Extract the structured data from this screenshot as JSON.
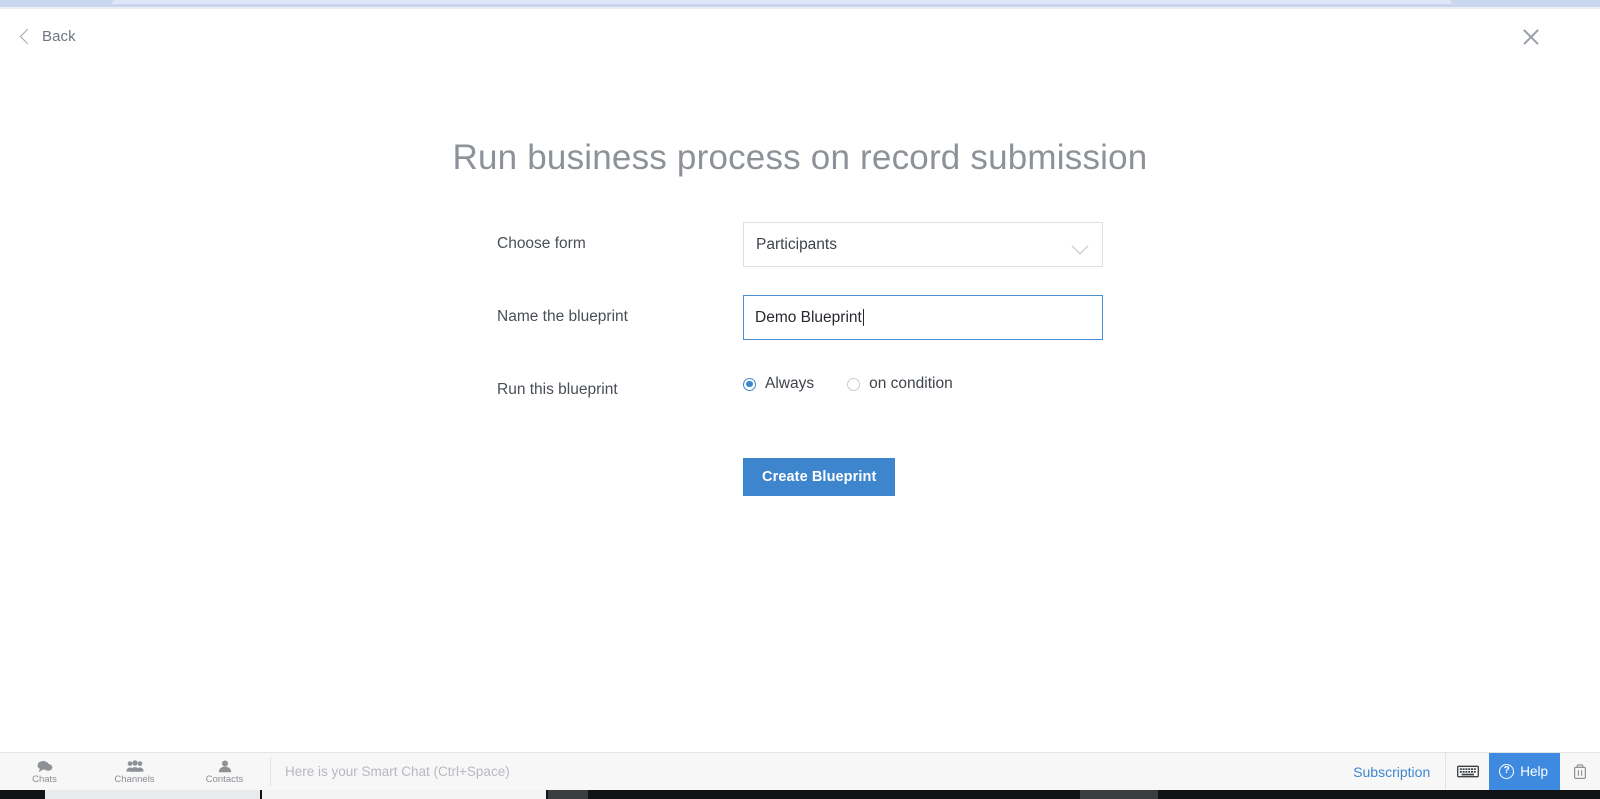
{
  "header": {
    "back_label": "Back",
    "back_icon": "chevron-left-icon",
    "close_icon": "close-icon"
  },
  "main": {
    "title": "Run business process on record submission",
    "rows": [
      {
        "label": "Choose form",
        "type": "select",
        "value": "Participants",
        "icon": "chevron-down-icon"
      },
      {
        "label": "Name the blueprint",
        "type": "text",
        "value": "Demo Blueprint",
        "placeholder": "",
        "focused": true
      },
      {
        "label": "Run this blueprint",
        "type": "radio",
        "options": [
          {
            "label": "Always",
            "selected": true
          },
          {
            "label": "on condition",
            "selected": false
          }
        ]
      }
    ],
    "submit_label": "Create Blueprint"
  },
  "bottom_bar": {
    "tabs": [
      {
        "label": "Chats",
        "icon": "chat-bubble-icon"
      },
      {
        "label": "Channels",
        "icon": "people-group-icon"
      },
      {
        "label": "Contacts",
        "icon": "person-icon"
      }
    ],
    "chat_placeholder": "Here is your Smart Chat (Ctrl+Space)",
    "subscription_label": "Subscription",
    "keyboard_icon": "keyboard-icon",
    "help_label": "Help",
    "help_icon": "question-circle-icon",
    "trash_icon": "trash-icon"
  },
  "colors": {
    "accent_blue": "#3d85cd",
    "help_blue": "#3e8ae0",
    "link_blue": "#3e87d0",
    "title_gray": "#8d9299",
    "focus_border": "#4b8fd4"
  }
}
